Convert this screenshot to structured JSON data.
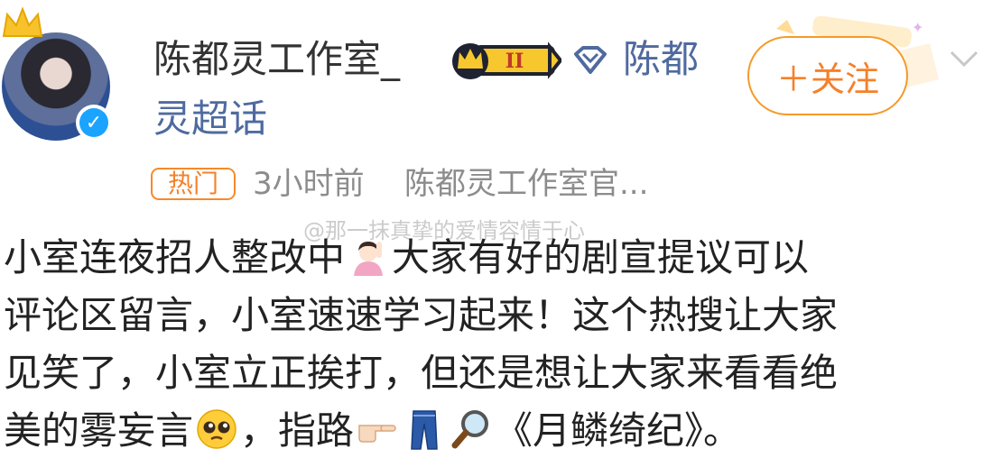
{
  "post": {
    "username": "陈都灵工作室_",
    "topic_link_line1": "陈都",
    "topic_link_line2": "灵超话",
    "follow_label": "＋关注",
    "hot_tag": "热门",
    "time": "3小时前",
    "source": "陈都灵工作室官...",
    "watermark": "@那一抹真挚的爱情容情于心",
    "body": {
      "line1a": "小室连夜招人整改中",
      "line1b": "大家有好的剧宣提议可以",
      "line2": "评论区留言，小室速速学习起来！这个热搜让大家",
      "line3": "见笑了，小室立正挨打，但还是想让大家来看看绝",
      "line4a": "美的雾妄言",
      "line4b": "，指路",
      "line4c": "《月鳞绮纪》。"
    }
  },
  "colors": {
    "follow_accent": "#f5812a",
    "topic_link": "#4f6a9f",
    "verified_blue": "#1aa3ff",
    "meta_gray": "#8c8c8c"
  },
  "icons": {
    "verified": "verified-badge-icon",
    "vip": "vip-crown-badge-icon",
    "topic": "super-topic-diamond-icon",
    "more": "chevron-down-icon"
  }
}
